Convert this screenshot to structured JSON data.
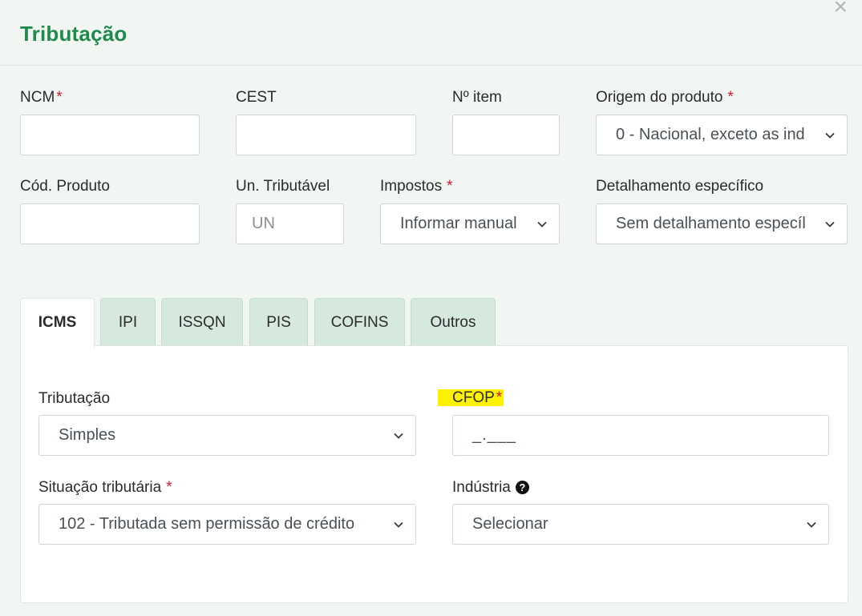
{
  "modal": {
    "title": "Tributação",
    "close_label": "×"
  },
  "fields": {
    "ncm": {
      "label": "NCM",
      "value": ""
    },
    "cest": {
      "label": "CEST",
      "value": ""
    },
    "item_number": {
      "label": "Nº item",
      "value": ""
    },
    "origin": {
      "label": "Origem do produto",
      "value": "0 - Nacional, exceto as ind"
    },
    "product_code": {
      "label": "Cód. Produto",
      "value": ""
    },
    "taxable_unit": {
      "label": "Un. Tributável",
      "placeholder": "UN"
    },
    "taxes": {
      "label": "Impostos",
      "value": "Informar manual"
    },
    "specific_detail": {
      "label": "Detalhamento específico",
      "value": "Sem detalhamento especíl"
    }
  },
  "required_marker": "*",
  "tabs": [
    {
      "label": "ICMS",
      "active": true
    },
    {
      "label": "IPI",
      "active": false
    },
    {
      "label": "ISSQN",
      "active": false
    },
    {
      "label": "PIS",
      "active": false
    },
    {
      "label": "COFINS",
      "active": false
    },
    {
      "label": "Outros",
      "active": false
    }
  ],
  "icms": {
    "tributacao": {
      "label": "Tributação",
      "value": "Simples"
    },
    "cfop": {
      "label": "CFOP",
      "placeholder": "_.___"
    },
    "situacao": {
      "label": "Situação tributária",
      "value": "102 - Tributada sem permissão de crédito"
    },
    "industria": {
      "label": "Indústria",
      "value": "Selecionar",
      "help_icon": "question-circle-icon"
    }
  },
  "colors": {
    "title": "#1f8a4c",
    "required": "#d0192c",
    "tab_inactive": "#d5e9df",
    "highlight": "#fff200",
    "background": "#f2f6f3"
  }
}
